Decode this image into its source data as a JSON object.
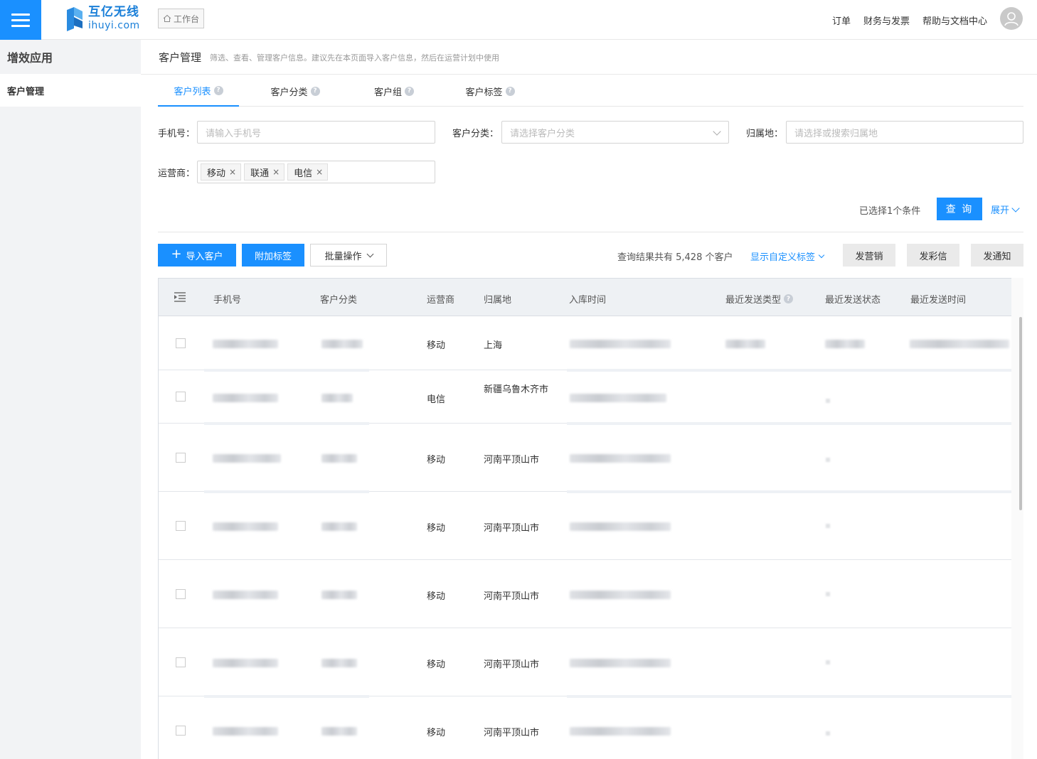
{
  "header": {
    "brand_cn": "互亿无线",
    "brand_en": "ihuyi.com",
    "workbench_label": "工作台",
    "nav": [
      "订单",
      "财务与发票",
      "帮助与文档中心"
    ]
  },
  "sidebar": {
    "title": "增效应用",
    "items": [
      {
        "label": "客户管理"
      }
    ]
  },
  "page": {
    "title": "客户管理",
    "description": "筛选、查看、管理客户信息。建议先在本页面导入客户信息，然后在运营计划中使用"
  },
  "tabs": [
    {
      "label": "客户列表",
      "active": true
    },
    {
      "label": "客户分类",
      "active": false
    },
    {
      "label": "客户组",
      "active": false
    },
    {
      "label": "客户标签",
      "active": false
    }
  ],
  "filters": {
    "phone": {
      "label": "手机号：",
      "placeholder": "请输入手机号"
    },
    "category": {
      "label": "客户分类：",
      "placeholder": "请选择客户分类"
    },
    "region": {
      "label": "归属地：",
      "placeholder": "请选择或搜索归属地"
    },
    "carrier": {
      "label": "运营商：",
      "tags": [
        "移动",
        "联通",
        "电信"
      ]
    },
    "condition_text": "已选择1个条件",
    "query_label": "查 询",
    "expand_label": "展开"
  },
  "toolbar": {
    "import_label": "导入客户",
    "tag_label": "附加标签",
    "batch_label": "批量操作",
    "result_text": "查询结果共有 5,428 个客户",
    "custom_tags_label": "显示自定义标签",
    "marketing_label": "发营销",
    "mms_label": "发彩信",
    "notify_label": "发通知"
  },
  "table": {
    "headers": {
      "phone": "手机号",
      "category": "客户分类",
      "carrier": "运营商",
      "region": "归属地",
      "created": "入库时间",
      "send_type": "最近发送类型",
      "send_status": "最近发送状态",
      "send_time": "最近发送时间"
    },
    "rows": [
      {
        "carrier": "移动",
        "region": "上海"
      },
      {
        "carrier": "电信",
        "region": "新疆乌鲁木齐市"
      },
      {
        "carrier": "移动",
        "region": "河南平顶山市"
      },
      {
        "carrier": "移动",
        "region": "河南平顶山市"
      },
      {
        "carrier": "移动",
        "region": "河南平顶山市"
      },
      {
        "carrier": "移动",
        "region": "河南平顶山市"
      },
      {
        "carrier": "移动",
        "region": "河南平顶山市"
      }
    ]
  },
  "colors": {
    "primary": "#1a90ff",
    "sidebar_bg": "#f2f3f5",
    "table_header_bg": "#eef1f4"
  }
}
